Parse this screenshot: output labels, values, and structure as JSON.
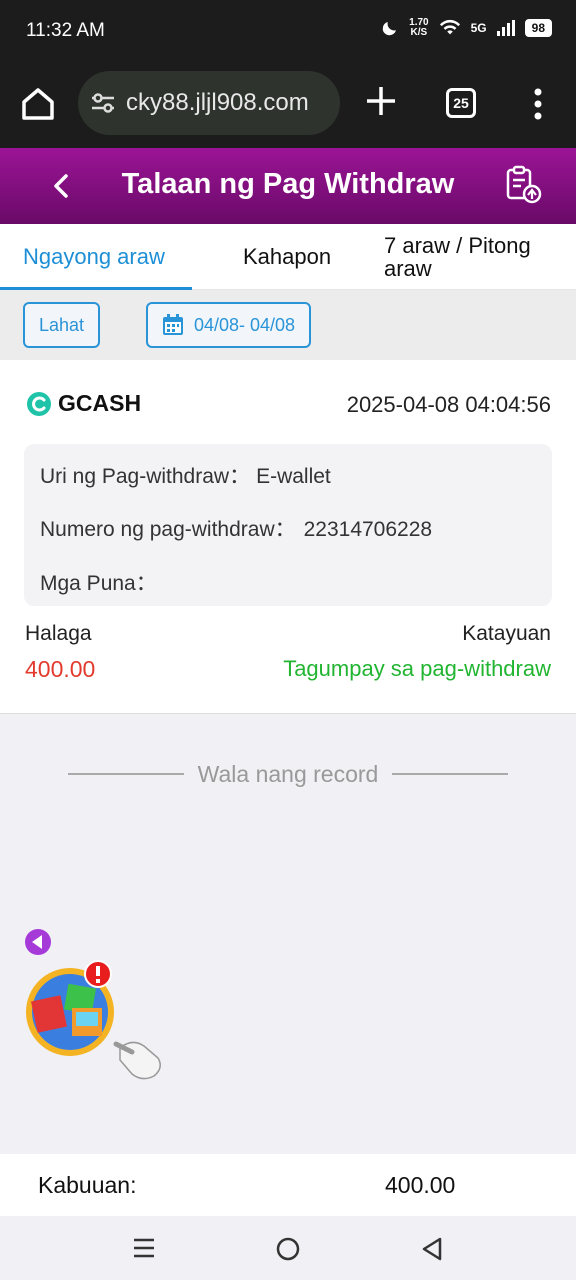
{
  "status_bar": {
    "time": "11:32 AM",
    "speed_value": "1.70",
    "speed_unit": "K/S",
    "network": "5G",
    "battery": "98"
  },
  "browser": {
    "url": "cky88.jljl908.com",
    "tab_count": "25"
  },
  "header": {
    "title": "Talaan ng Pag Withdraw"
  },
  "tabs": [
    {
      "label": "Ngayong araw",
      "active": true
    },
    {
      "label": "Kahapon",
      "active": false
    },
    {
      "label": "7 araw / Pitong araw",
      "active": false
    }
  ],
  "filters": {
    "all_label": "Lahat",
    "date_range": "04/08- 04/08"
  },
  "record": {
    "method": "GCASH",
    "datetime": "2025-04-08 04:04:56",
    "type_label": "Uri ng Pag-withdraw：",
    "type_value": "E-wallet",
    "number_label": "Numero ng pag-withdraw：",
    "number_value": "22314706228",
    "remarks_label": "Mga Puna：",
    "remarks_value": "",
    "amount_label": "Halaga",
    "amount_value": "400.00",
    "status_label": "Katayuan",
    "status_value": "Tagumpay sa pag-withdraw"
  },
  "no_record_text": "Wala nang record",
  "total": {
    "label": "Kabuuan:",
    "value": "400.00"
  },
  "colors": {
    "header_gradient_top": "#9b1496",
    "header_gradient_bottom": "#6a0a68",
    "accent_blue": "#1e8fd6",
    "amount_red": "#e23b2e",
    "status_green": "#22b532"
  }
}
